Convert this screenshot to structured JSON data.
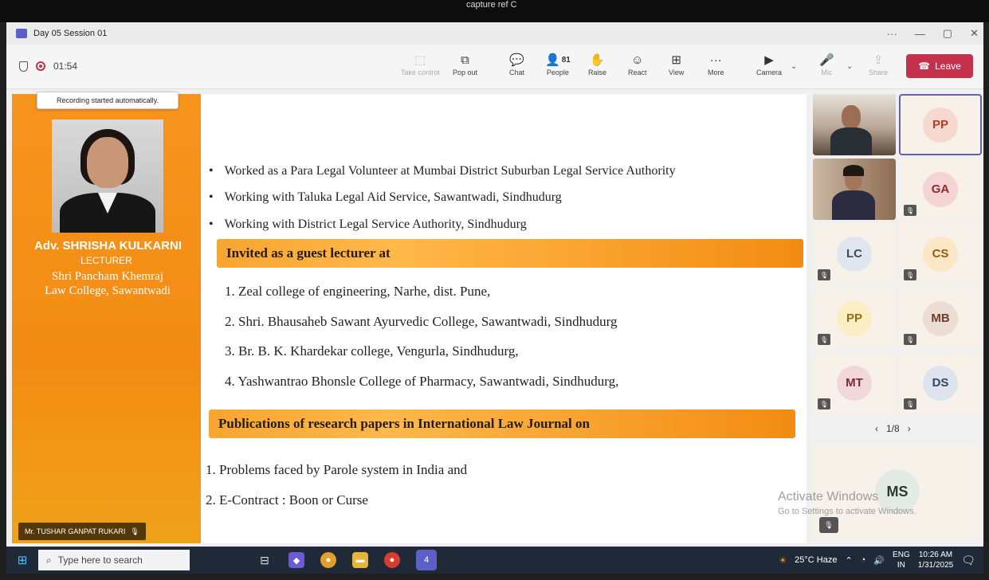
{
  "capture_title": "capture ref C",
  "window": {
    "title": "Day 05 Session 01",
    "more": "···",
    "minimize": "—",
    "restore": "▢",
    "close": "✕"
  },
  "meeting": {
    "timer": "01:54",
    "tooltip": "Recording started automatically."
  },
  "toolbar": {
    "take_control": "Take control",
    "pop_out": "Pop out",
    "chat": "Chat",
    "people": "People",
    "people_count": "81",
    "raise": "Raise",
    "react": "React",
    "view": "View",
    "more": "More",
    "camera": "Camera",
    "mic": "Mic",
    "share": "Share",
    "leave": "Leave"
  },
  "slide": {
    "speaker_name": "Adv. SHRISHA KULKARNI",
    "speaker_role": "LECTURER",
    "speaker_institution_line1": "Shri Pancham Khemraj",
    "speaker_institution_line2": "Law College, Sawantwadi",
    "bullets": [
      "Worked as a Para Legal Volunteer at Mumbai District Suburban Legal Service Authority",
      "Working with Taluka Legal Aid Service, Sawantwadi, Sindhudurg",
      "Working with District Legal Service Authority, Sindhudurg"
    ],
    "guest_heading": "Invited as a guest lecturer at",
    "guest_list": [
      "1.  Zeal college of engineering, Narhe, dist. Pune,",
      "2.  Shri. Bhausaheb Sawant Ayurvedic College, Sawantwadi, Sindhudurg",
      "3.  Br. B. K. Khardekar college, Vengurla, Sindhudurg,",
      "4.  Yashwantrao Bhonsle College of Pharmacy, Sawantwadi, Sindhudurg,"
    ],
    "pub_heading": "Publications of research papers in International Law Journal on",
    "pub_list": [
      "1.  Problems faced by Parole system in India  and",
      "2.  E-Contract : Boon or Curse"
    ]
  },
  "presenter_tag": "Mr. TUSHAR GANPAT RUKARI",
  "participants": [
    {
      "initials": "PP",
      "color": "#f6d8cf",
      "text_color": "#b23d22"
    },
    {
      "initials": "GA",
      "color": "#f3d3d3",
      "text_color": "#8a2d2d"
    },
    {
      "initials": "LC",
      "color": "#dfe6ee",
      "text_color": "#3b4a5c"
    },
    {
      "initials": "CS",
      "color": "#fbe6c6",
      "text_color": "#9a5a10"
    },
    {
      "initials": "PP",
      "color": "#fbeec2",
      "text_color": "#9a6a10"
    },
    {
      "initials": "MB",
      "color": "#ecdcd3",
      "text_color": "#6a3e2a"
    },
    {
      "initials": "MT",
      "color": "#f1d7d7",
      "text_color": "#7a2d2d"
    },
    {
      "initials": "DS",
      "color": "#dde4ee",
      "text_color": "#34475e"
    }
  ],
  "pager": {
    "text": "1/8",
    "prev": "‹",
    "next": "›"
  },
  "ms_tile": {
    "initials": "MS"
  },
  "watermark": {
    "line1": "Activate Windows",
    "line2": "Go to Settings to activate Windows."
  },
  "taskbar": {
    "search_placeholder": "Type here to search",
    "weather": "25°C  Haze",
    "lang1": "ENG",
    "lang2": "IN",
    "time": "10:26 AM",
    "date": "1/31/2025",
    "teams_badge": "4"
  }
}
